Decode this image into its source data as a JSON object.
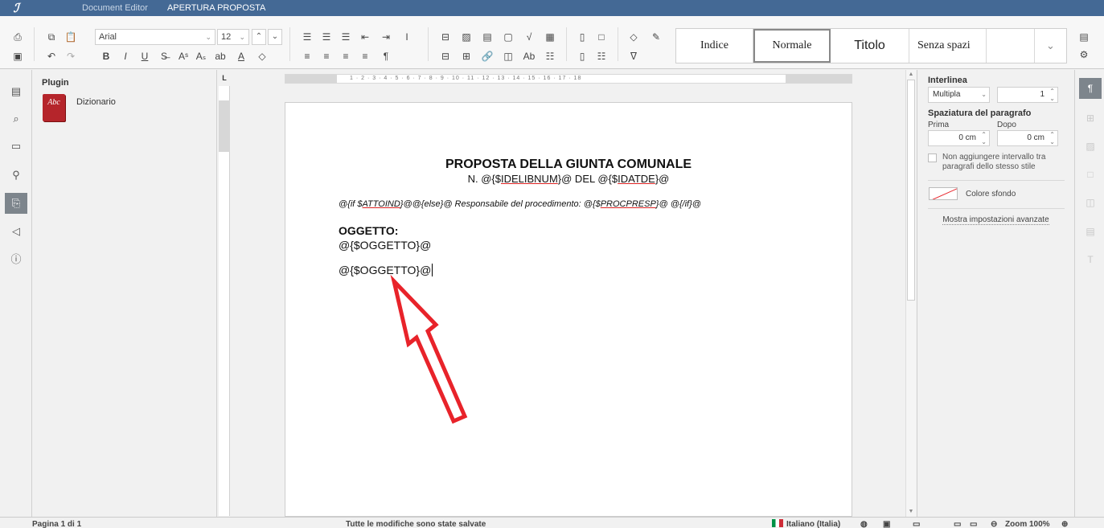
{
  "titlebar": {
    "logo": "ℐ",
    "tab_inactive": "Document Editor",
    "tab_active": "APERTURA PROPOSTA",
    "color": "#446995"
  },
  "toolbar": {
    "font_name": "Arial",
    "font_size": "12",
    "styles": [
      "Indice",
      "Normale",
      "Titolo",
      "Senza spazi"
    ],
    "selected_style": "Normale"
  },
  "left_rail": {
    "icons": [
      "file-icon",
      "search-icon",
      "comment-icon",
      "user-icon",
      "plugin-icon",
      "megaphone-icon",
      "info-icon"
    ],
    "active": "plugin-icon"
  },
  "plugin_panel": {
    "title": "Plugin",
    "items": [
      {
        "thumb": "Abc",
        "label": "Dizionario"
      }
    ]
  },
  "ruler": {
    "corner": "L",
    "labels": "1 · 2 · 3 · 4 · 5 · 6 · 7 · 8 · 9 · 10 · 11 · 12 · 13 · 14 · 15 · 16 · 17 · 18"
  },
  "document": {
    "title": "PROPOSTA DELLA GIUNTA COMUNALE",
    "sub_prefix": "N. @{$",
    "sub_var1": "IDELIBNUM",
    "sub_middle": "}@ DEL @{$",
    "sub_var2": "IDATDE",
    "sub_suffix": "}@",
    "cond_if": "@{if $",
    "cond_var": "ATTOIND",
    "cond_else": "}@@{else}@ Responsabile del procedimento: @{$",
    "cond_var2": "PROCPRESP",
    "cond_end": "}@ @{/if}@",
    "oggetto_label": "OGGETTO:",
    "oggetto_line1": "@{$OGGETTO}@",
    "oggetto_line2": "@{$OGGETTO}@"
  },
  "right_panel": {
    "interlinea_label": "Interlinea",
    "interlinea_type": "Multipla",
    "interlinea_value": "1",
    "spacing_label": "Spaziatura del paragrafo",
    "before_label": "Prima",
    "after_label": "Dopo",
    "before_value": "0 cm",
    "after_value": "0 cm",
    "no_interval_label": "Non aggiungere intervallo tra paragrafi dello stesso stile",
    "bg_color_label": "Colore sfondo",
    "advanced_link": "Mostra impostazioni avanzate"
  },
  "right_rail": {
    "icons": [
      "paragraph-icon",
      "table-icon",
      "image-icon",
      "header-footer-icon",
      "shape-icon",
      "chart-icon",
      "text-art-icon"
    ],
    "active": "paragraph-icon"
  },
  "status": {
    "page": "Pagina 1 di 1",
    "saved": "Tutte le modifiche sono state salvate",
    "language": "Italiano (Italia)",
    "zoom": "Zoom 100%"
  },
  "annotation": {
    "arrow_color": "#e8232a"
  }
}
